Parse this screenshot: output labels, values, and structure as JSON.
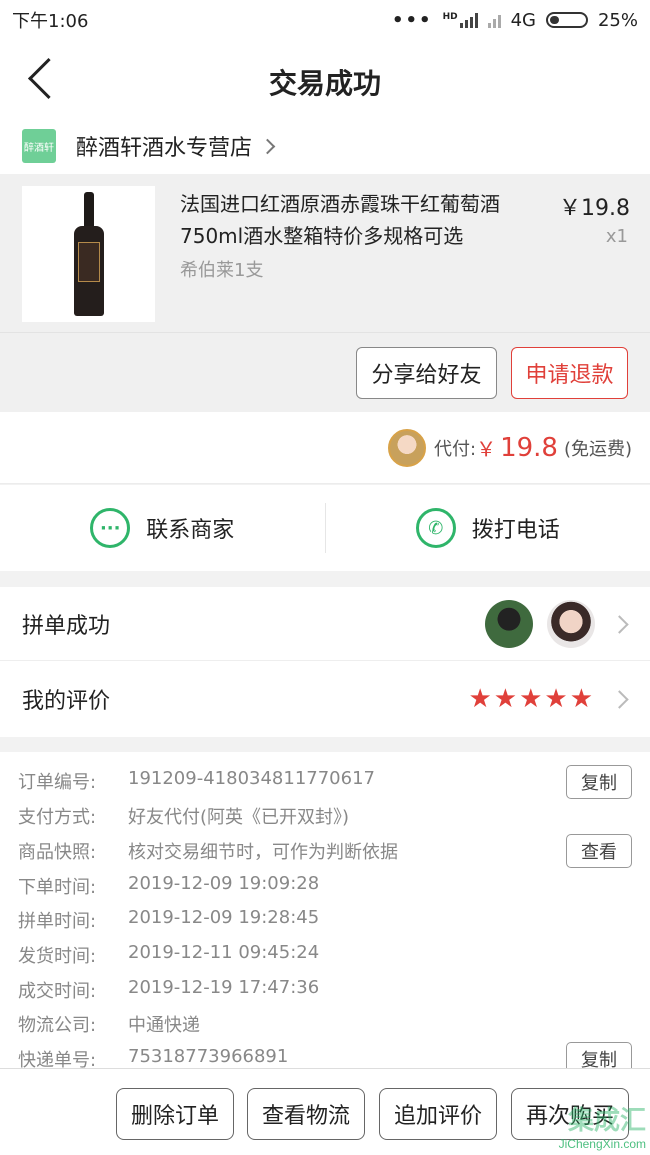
{
  "status_bar": {
    "time": "下午1:06",
    "network": "4G",
    "battery": "25%",
    "hd": "HD"
  },
  "nav": {
    "title": "交易成功"
  },
  "store": {
    "logo_text": "醉酒轩",
    "name": "醉酒轩酒水专营店"
  },
  "product": {
    "title": "法国进口红酒原酒赤霞珠干红葡萄酒750ml酒水整箱特价多规格可选",
    "sku": "希伯莱1支",
    "price": "￥19.8",
    "qty": "x1"
  },
  "actions": {
    "share": "分享给好友",
    "refund": "申请退款"
  },
  "payment": {
    "label": "代付:",
    "currency": "￥",
    "amount": "19.8",
    "shipping": "(免运费)"
  },
  "contact": {
    "merchant": "联系商家",
    "call": "拨打电话"
  },
  "group": {
    "success": "拼单成功",
    "my_review": "我的评价",
    "stars": "★★★★★",
    "rating": 5
  },
  "details": [
    {
      "label": "订单编号:",
      "value": "191209-418034811770617",
      "button": "复制"
    },
    {
      "label": "支付方式:",
      "value": "好友代付(阿英《已开双封》)"
    },
    {
      "label": "商品快照:",
      "value": "核对交易细节时，可作为判断依据",
      "button": "查看"
    },
    {
      "label": "下单时间:",
      "value": "2019-12-09 19:09:28"
    },
    {
      "label": "拼单时间:",
      "value": "2019-12-09 19:28:45"
    },
    {
      "label": "发货时间:",
      "value": "2019-12-11 09:45:24"
    },
    {
      "label": "成交时间:",
      "value": "2019-12-19 17:47:36"
    },
    {
      "label": "物流公司:",
      "value": "中通快递"
    },
    {
      "label": "快递单号:",
      "value": "75318773966891",
      "button": "复制"
    }
  ],
  "bottom": {
    "delete": "删除订单",
    "logistics": "查看物流",
    "add_review": "追加评价",
    "rebuy": "再次购买"
  },
  "watermark": {
    "big": "集成汇",
    "url": "JiChengXin.com"
  },
  "colors": {
    "accent_red": "#e0403a",
    "green": "#2fb56a"
  }
}
